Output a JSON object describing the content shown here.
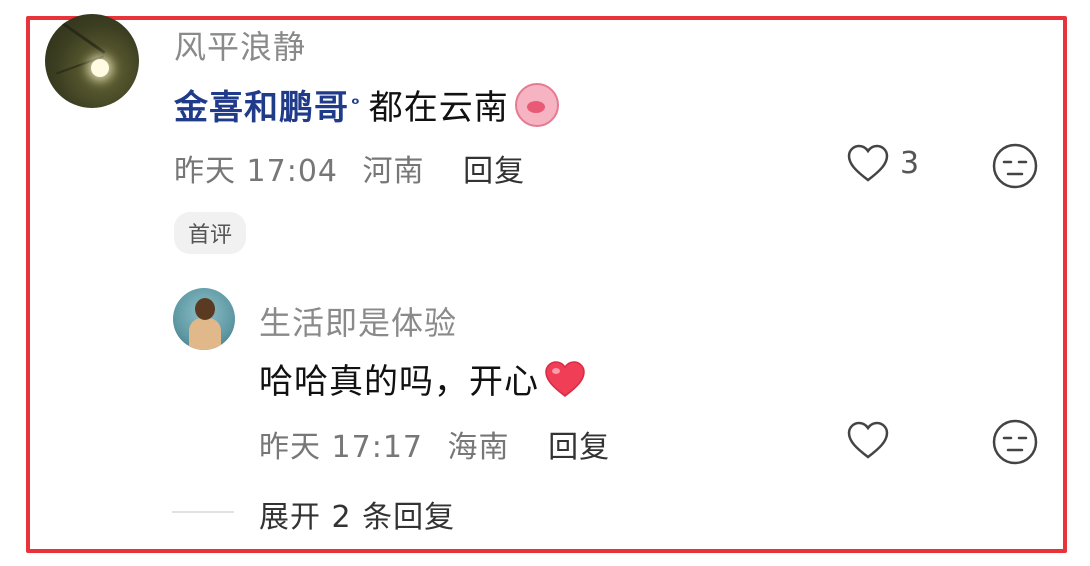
{
  "comment": {
    "username": "风平浪静",
    "mention": "金喜和鹏哥",
    "text": "都在云南",
    "emoji": "pig-laughing-emoji",
    "time": "昨天 17:04",
    "location": "河南",
    "reply_label": "回复",
    "like_count": "3",
    "tag": "首评"
  },
  "reply": {
    "username": "生活即是体验",
    "text": "哈哈真的吗，开心",
    "emoji": "red-heart-emoji",
    "time": "昨天 17:17",
    "location": "海南",
    "reply_label": "回复"
  },
  "expand_label": "展开 2 条回复",
  "colors": {
    "frame": "#e8333b",
    "mention": "#1f3b8a",
    "heart": "#e8333b"
  }
}
